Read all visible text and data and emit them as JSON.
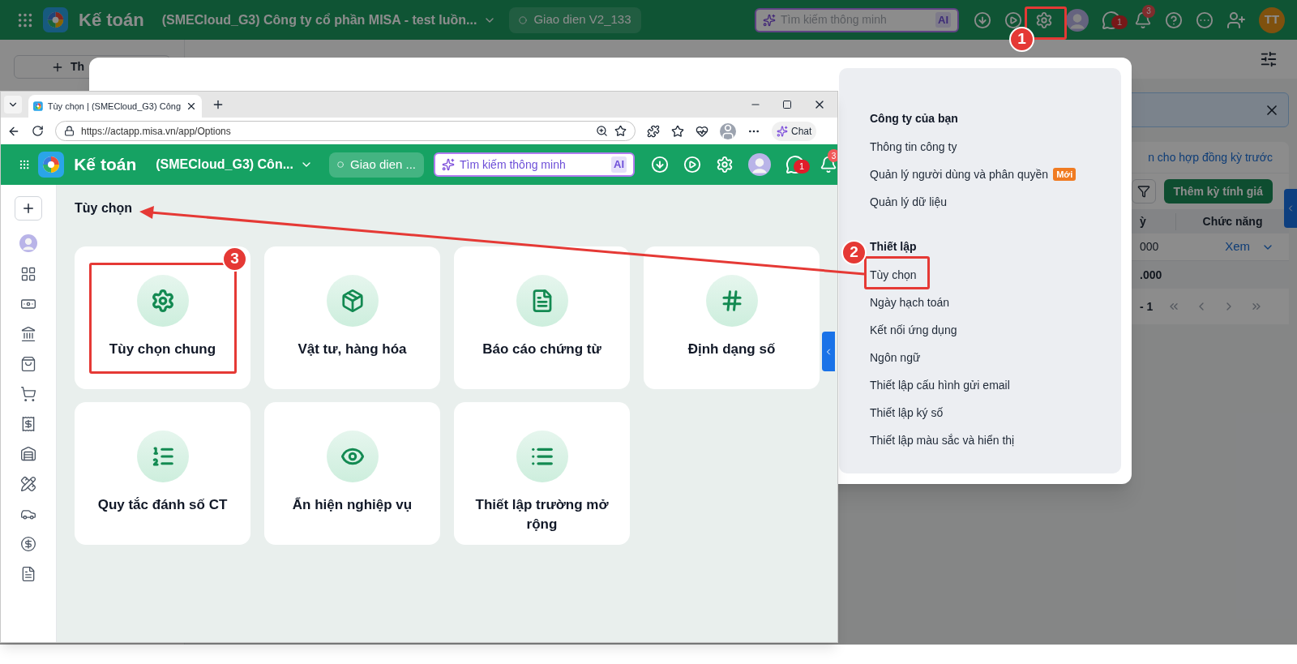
{
  "background_app": {
    "header": {
      "app_name": "Kế toán",
      "company": "(SMECloud_G3) Công ty cổ phần MISA - test luồn...",
      "interface_label": "Giao dien V2_133",
      "search_placeholder": "Tìm kiếm thông minh",
      "ai_label": "AI",
      "chat_badge": "1",
      "notification_badge": "3",
      "avatar_initials": "TT"
    },
    "sidebar_button": "Th",
    "banner_link": "n cho hợp đồng kỳ trước",
    "add_button": "Thêm kỳ tính giá",
    "table": {
      "columns": [
        "ỳ",
        "Chức năng"
      ],
      "rows": [
        {
          "column_1": "000",
          "action": "Xem"
        }
      ],
      "total": ".000"
    },
    "pagination": "- 1"
  },
  "settings_panel": {
    "sections": [
      {
        "title": "Công ty của bạn",
        "items": [
          {
            "label": "Thông tin công ty"
          },
          {
            "label": "Quản lý người dùng và phân quyền",
            "badge": "Mới"
          },
          {
            "label": "Quản lý dữ liệu"
          }
        ]
      },
      {
        "title": "Thiết lập",
        "items": [
          {
            "label": "Tùy chọn"
          },
          {
            "label": "Ngày hạch toán"
          },
          {
            "label": "Kết nối ứng dụng"
          },
          {
            "label": "Ngôn ngữ"
          },
          {
            "label": "Thiết lập cấu hình gửi email"
          },
          {
            "label": "Thiết lập ký số"
          },
          {
            "label": "Thiết lập màu sắc và hiển thị"
          }
        ]
      }
    ]
  },
  "browser": {
    "tab_title": "Tùy chọn | (SMECloud_G3) Công",
    "url": "https://actapp.misa.vn/app/Options",
    "chat_label": "Chat",
    "app": {
      "header": {
        "app_name": "Kế toán",
        "company": "(SMECloud_G3) Côn...",
        "interface_label": "Giao dien ...",
        "search_placeholder": "Tìm kiếm thông minh",
        "ai_label": "AI",
        "chat_badge": "1",
        "notification_badge": "3"
      },
      "page_title": "Tùy chọn",
      "cards": [
        {
          "label": "Tùy chọn chung",
          "kind": "gear"
        },
        {
          "label": "Vật tư, hàng hóa",
          "kind": "goods"
        },
        {
          "label": "Báo cáo chứng từ",
          "kind": "report"
        },
        {
          "label": "Định dạng số",
          "kind": "number-format"
        },
        {
          "label": "Quy tắc đánh số CT",
          "kind": "numbering"
        },
        {
          "label": "Ẩn hiện nghiệp vụ",
          "kind": "visibility"
        },
        {
          "label": "Thiết lập trường mở rộng",
          "kind": "fields"
        }
      ]
    }
  },
  "annotations": [
    {
      "number": "1"
    },
    {
      "number": "2"
    },
    {
      "number": "3"
    }
  ]
}
